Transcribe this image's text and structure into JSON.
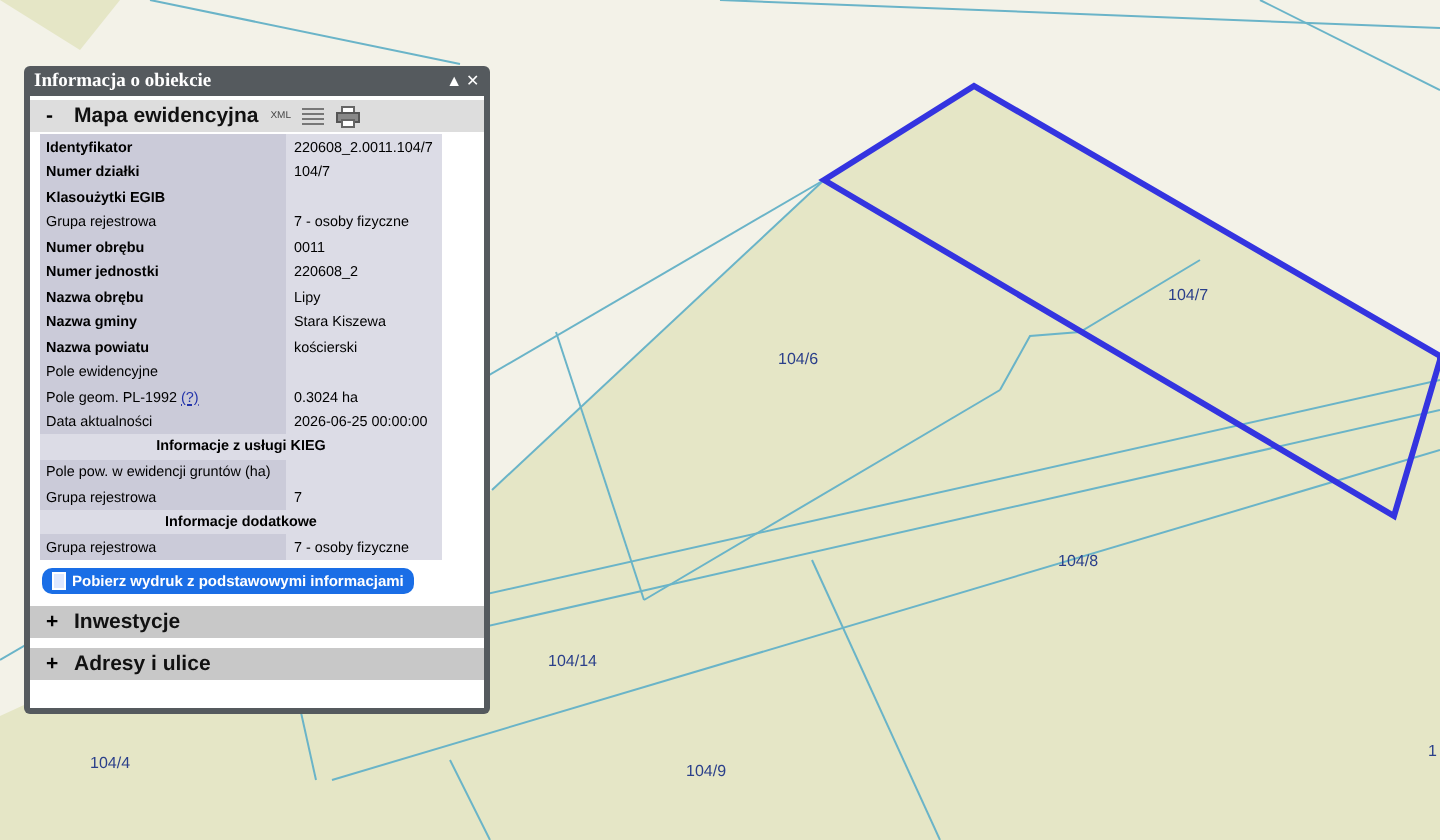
{
  "panel": {
    "title": "Informacja o obiekcie",
    "controls": [
      "▲",
      "✕"
    ],
    "section": {
      "label": "Mapa ewidencyjna",
      "toggle": "-",
      "xml": "XML"
    },
    "rows": [
      {
        "kind": "field",
        "label": "Identyfikator",
        "value": "220608_2.0011.104/7",
        "bold": true
      },
      {
        "kind": "field",
        "label": "Numer działki",
        "value": "104/7",
        "bold": true
      },
      {
        "kind": "field",
        "label": "Klasoużytki EGIB",
        "value": "",
        "bold": true
      },
      {
        "kind": "field",
        "label": "Grupa rejestrowa",
        "value": "7 - osoby fizyczne",
        "bold": false
      },
      {
        "kind": "field",
        "label": "Numer obrębu",
        "value": "0011",
        "bold": true
      },
      {
        "kind": "field",
        "label": "Numer jednostki",
        "value": "220608_2",
        "bold": true
      },
      {
        "kind": "field",
        "label": "Nazwa obrębu",
        "value": "Lipy",
        "bold": true
      },
      {
        "kind": "field",
        "label": "Nazwa gminy",
        "value": "Stara Kiszewa",
        "bold": true
      },
      {
        "kind": "field",
        "label": "Nazwa powiatu",
        "value": "kościerski",
        "bold": true
      },
      {
        "kind": "field",
        "label": "Pole ewidencyjne",
        "value": "",
        "bold": false
      },
      {
        "kind": "field",
        "label": "Pole geom. PL-1992",
        "help": "(?)",
        "value": "0.3024 ha",
        "bold": false
      },
      {
        "kind": "field",
        "label": "Data aktualności",
        "value": "2026-06-25 00:00:00",
        "bold": false
      },
      {
        "kind": "heading",
        "label": "Informacje z usługi KIEG"
      },
      {
        "kind": "field",
        "label": "Pole pow. w ewidencji gruntów (ha)",
        "value": "",
        "bold": false
      },
      {
        "kind": "field",
        "label": "Grupa rejestrowa",
        "value": "7",
        "bold": false
      },
      {
        "kind": "heading",
        "label": "Informacje dodatkowe"
      },
      {
        "kind": "field",
        "label": "Grupa rejestrowa",
        "value": "7 - osoby fizyczne",
        "bold": false
      }
    ],
    "print_button": "Pobierz wydruk z podstawowymi informacjami",
    "collapsed": [
      {
        "toggle": "+",
        "label": "Inwestycje"
      },
      {
        "toggle": "+",
        "label": "Adresy i ulice"
      }
    ]
  },
  "map": {
    "labels": [
      "104/7",
      "104/6",
      "104/8",
      "104/14",
      "104/4",
      "104/9",
      "1"
    ]
  }
}
